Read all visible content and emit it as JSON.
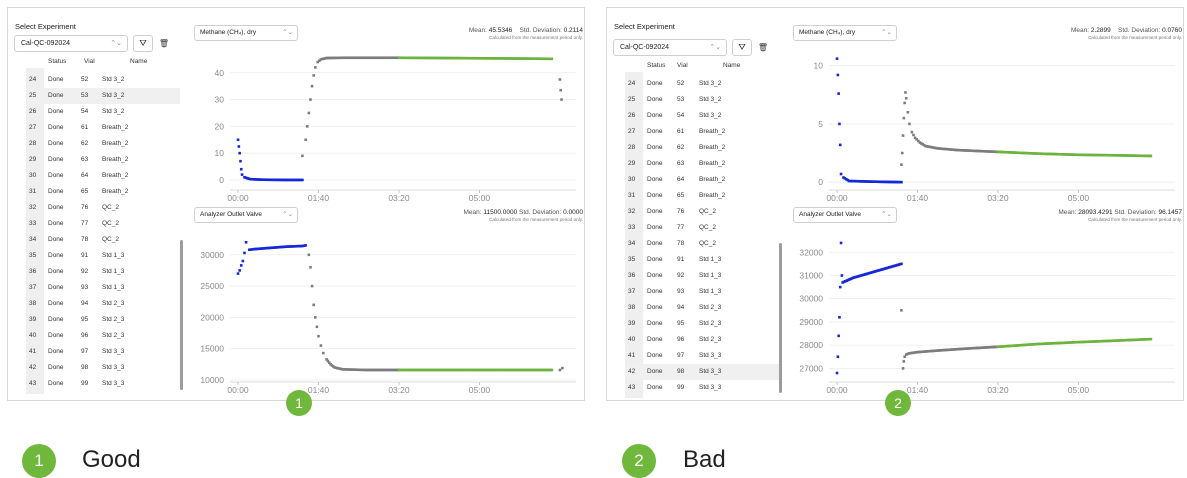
{
  "panels": [
    {
      "select_title": "Select Experiment",
      "experiment": "Cal-QC-092024",
      "columns": [
        "Status",
        "Vial",
        "Name"
      ],
      "rows": [
        {
          "n": "24",
          "status": "Done",
          "vial": "52",
          "name": "Std 3_2"
        },
        {
          "n": "25",
          "status": "Done",
          "vial": "53",
          "name": "Std 3_2"
        },
        {
          "n": "26",
          "status": "Done",
          "vial": "54",
          "name": "Std 3_2"
        },
        {
          "n": "27",
          "status": "Done",
          "vial": "61",
          "name": "Breath_2"
        },
        {
          "n": "28",
          "status": "Done",
          "vial": "62",
          "name": "Breath_2"
        },
        {
          "n": "29",
          "status": "Done",
          "vial": "63",
          "name": "Breath_2"
        },
        {
          "n": "30",
          "status": "Done",
          "vial": "64",
          "name": "Breath_2"
        },
        {
          "n": "31",
          "status": "Done",
          "vial": "65",
          "name": "Breath_2"
        },
        {
          "n": "32",
          "status": "Done",
          "vial": "76",
          "name": "QC_2"
        },
        {
          "n": "33",
          "status": "Done",
          "vial": "77",
          "name": "QC_2"
        },
        {
          "n": "34",
          "status": "Done",
          "vial": "78",
          "name": "QC_2"
        },
        {
          "n": "35",
          "status": "Done",
          "vial": "91",
          "name": "Std 1_3"
        },
        {
          "n": "36",
          "status": "Done",
          "vial": "92",
          "name": "Std 1_3"
        },
        {
          "n": "37",
          "status": "Done",
          "vial": "93",
          "name": "Std 1_3"
        },
        {
          "n": "38",
          "status": "Done",
          "vial": "94",
          "name": "Std 2_3"
        },
        {
          "n": "39",
          "status": "Done",
          "vial": "95",
          "name": "Std 2_3"
        },
        {
          "n": "40",
          "status": "Done",
          "vial": "96",
          "name": "Std 2_3"
        },
        {
          "n": "41",
          "status": "Done",
          "vial": "97",
          "name": "Std 3_3"
        },
        {
          "n": "42",
          "status": "Done",
          "vial": "98",
          "name": "Std 3_3"
        },
        {
          "n": "43",
          "status": "Done",
          "vial": "99",
          "name": "Std 3_3"
        }
      ],
      "selected_row": "25",
      "chart1": {
        "select": "Methane (CH₄), dry",
        "mean_label": "Mean:",
        "mean": "45.5346",
        "sd_label": "Std. Deviation:",
        "sd": "0.2114",
        "note": "Calculated from the measurement period only."
      },
      "chart2": {
        "select": "Analyzer Outlet Valve",
        "mean_label": "Mean:",
        "mean": "11500.0000",
        "sd_label": "Std. Deviation:",
        "sd": "0.0000",
        "note": "Calculated from the measurement period only."
      },
      "badge": "1",
      "caption": "Good"
    },
    {
      "select_title": "Select Experiment",
      "experiment": "Cal-QC-092024",
      "columns": [
        "Status",
        "Vial",
        "Name"
      ],
      "rows": [
        {
          "n": "24",
          "status": "Done",
          "vial": "52",
          "name": "Std 3_2"
        },
        {
          "n": "25",
          "status": "Done",
          "vial": "53",
          "name": "Std 3_2"
        },
        {
          "n": "26",
          "status": "Done",
          "vial": "54",
          "name": "Std 3_2"
        },
        {
          "n": "27",
          "status": "Done",
          "vial": "61",
          "name": "Breath_2"
        },
        {
          "n": "28",
          "status": "Done",
          "vial": "62",
          "name": "Breath_2"
        },
        {
          "n": "29",
          "status": "Done",
          "vial": "63",
          "name": "Breath_2"
        },
        {
          "n": "30",
          "status": "Done",
          "vial": "64",
          "name": "Breath_2"
        },
        {
          "n": "31",
          "status": "Done",
          "vial": "65",
          "name": "Breath_2"
        },
        {
          "n": "32",
          "status": "Done",
          "vial": "76",
          "name": "QC_2"
        },
        {
          "n": "33",
          "status": "Done",
          "vial": "77",
          "name": "QC_2"
        },
        {
          "n": "34",
          "status": "Done",
          "vial": "78",
          "name": "QC_2"
        },
        {
          "n": "35",
          "status": "Done",
          "vial": "91",
          "name": "Std 1_3"
        },
        {
          "n": "36",
          "status": "Done",
          "vial": "92",
          "name": "Std 1_3"
        },
        {
          "n": "37",
          "status": "Done",
          "vial": "93",
          "name": "Std 1_3"
        },
        {
          "n": "38",
          "status": "Done",
          "vial": "94",
          "name": "Std 2_3"
        },
        {
          "n": "39",
          "status": "Done",
          "vial": "95",
          "name": "Std 2_3"
        },
        {
          "n": "40",
          "status": "Done",
          "vial": "96",
          "name": "Std 2_3"
        },
        {
          "n": "41",
          "status": "Done",
          "vial": "97",
          "name": "Std 3_3"
        },
        {
          "n": "42",
          "status": "Done",
          "vial": "98",
          "name": "Std 3_3"
        },
        {
          "n": "43",
          "status": "Done",
          "vial": "99",
          "name": "Std 3_3"
        }
      ],
      "selected_row": "42",
      "chart1": {
        "select": "Methane (CH₄), dry",
        "mean_label": "Mean:",
        "mean": "2.2899",
        "sd_label": "Std. Deviation:",
        "sd": "0.0760",
        "note": "Calculated from the measurement period only."
      },
      "chart2": {
        "select": "Analyzer Outlet Valve",
        "mean_label": "Mean:",
        "mean": "28093.4291",
        "sd_label": "Std. Deviation:",
        "sd": "96.1457",
        "note": "Calculated from the measurement period only."
      },
      "badge": "2",
      "caption": "Bad"
    }
  ],
  "colors": {
    "blue": "#1428d8",
    "grey": "#7d7d7d",
    "green": "#6cb33f",
    "badge": "#70b83c"
  },
  "icons": {
    "filter": "filter-icon",
    "trash": "trash-icon",
    "chevron": "chevron-updown-icon"
  },
  "chart_data": [
    {
      "type": "scatter",
      "panel": "1",
      "title": "",
      "xlabel": "",
      "ylabel": "",
      "xticks": [
        "00:00",
        "01:40",
        "03:20",
        "05:00"
      ],
      "xlim": [
        -10,
        420
      ],
      "ylim": [
        -3,
        47
      ],
      "yticks": [
        0,
        10,
        20,
        30,
        40
      ],
      "series": [
        {
          "color": "blue",
          "points": [
            [
              0,
              15
            ],
            [
              1,
              12.5
            ],
            [
              2,
              10
            ],
            [
              3,
              7
            ],
            [
              4,
              4
            ],
            [
              5,
              2
            ],
            [
              8,
              1
            ],
            [
              15,
              0.3
            ],
            [
              30,
              0.1
            ],
            [
              60,
              0
            ],
            [
              80,
              0
            ]
          ]
        },
        {
          "color": "grey",
          "points": [
            [
              80,
              9
            ],
            [
              84,
              15
            ],
            [
              86,
              20
            ],
            [
              88,
              25
            ],
            [
              90,
              30
            ],
            [
              92,
              35
            ],
            [
              94,
              39
            ],
            [
              96,
              42
            ],
            [
              99,
              44
            ],
            [
              103,
              45
            ],
            [
              110,
              45.5
            ],
            [
              130,
              45.6
            ],
            [
              160,
              45.6
            ],
            [
              200,
              45.6
            ]
          ]
        },
        {
          "color": "green",
          "points": [
            [
              200,
              45.6
            ],
            [
              250,
              45.5
            ],
            [
              300,
              45.4
            ],
            [
              350,
              45.3
            ],
            [
              390,
              45.2
            ]
          ]
        },
        {
          "color": "grey",
          "points": [
            [
              400,
              37.5
            ],
            [
              401,
              33.5
            ],
            [
              402,
              30
            ]
          ]
        }
      ]
    },
    {
      "type": "scatter",
      "panel": "1",
      "title": "",
      "xlabel": "",
      "ylabel": "",
      "xticks": [
        "00:00",
        "01:40",
        "03:20",
        "05:00"
      ],
      "xlim": [
        -10,
        420
      ],
      "ylim": [
        10000,
        33000
      ],
      "yticks": [
        10000,
        15000,
        20000,
        25000,
        30000
      ],
      "series": [
        {
          "color": "blue",
          "points": [
            [
              0,
              27000
            ],
            [
              2,
              27500
            ],
            [
              4,
              28300
            ],
            [
              6,
              29000
            ],
            [
              8,
              30300
            ],
            [
              10,
              32000
            ],
            [
              14,
              30800
            ],
            [
              20,
              30900
            ],
            [
              40,
              31100
            ],
            [
              60,
              31300
            ],
            [
              80,
              31400
            ],
            [
              84,
              31500
            ]
          ]
        },
        {
          "color": "grey",
          "points": [
            [
              88,
              30000
            ],
            [
              90,
              28000
            ],
            [
              92,
              25000
            ],
            [
              94,
              22000
            ],
            [
              96,
              20000
            ],
            [
              98,
              18500
            ],
            [
              100,
              17000
            ],
            [
              103,
              15500
            ],
            [
              106,
              14300
            ],
            [
              110,
              13300
            ],
            [
              115,
              12500
            ],
            [
              120,
              12000
            ],
            [
              130,
              11700
            ],
            [
              160,
              11600
            ],
            [
              200,
              11600
            ]
          ]
        },
        {
          "color": "green",
          "points": [
            [
              200,
              11600
            ],
            [
              250,
              11600
            ],
            [
              300,
              11600
            ],
            [
              350,
              11600
            ],
            [
              390,
              11600
            ]
          ]
        },
        {
          "color": "grey",
          "points": [
            [
              400,
              11600
            ],
            [
              403,
              11900
            ]
          ]
        }
      ]
    },
    {
      "type": "scatter",
      "panel": "2",
      "title": "",
      "xlabel": "",
      "ylabel": "",
      "xticks": [
        "00:00",
        "01:40",
        "03:20",
        "05:00"
      ],
      "xlim": [
        -10,
        420
      ],
      "ylim": [
        -0.5,
        11
      ],
      "yticks": [
        0,
        5,
        10
      ],
      "series": [
        {
          "color": "blue",
          "points": [
            [
              0,
              10.6
            ],
            [
              1,
              9.2
            ],
            [
              2,
              7.6
            ],
            [
              3,
              5
            ],
            [
              4,
              3.2
            ],
            [
              5,
              0.7
            ],
            [
              8,
              0.4
            ],
            [
              15,
              0.1
            ],
            [
              40,
              0.05
            ],
            [
              80,
              0
            ]
          ]
        },
        {
          "color": "grey",
          "points": [
            [
              80,
              1.5
            ],
            [
              81,
              2.5
            ],
            [
              82,
              4
            ],
            [
              83,
              5.5
            ],
            [
              84,
              6.8
            ],
            [
              85,
              7.7
            ],
            [
              86,
              7.2
            ],
            [
              88,
              6
            ],
            [
              90,
              5
            ],
            [
              93,
              4.3
            ],
            [
              97,
              3.8
            ],
            [
              103,
              3.4
            ],
            [
              110,
              3.1
            ],
            [
              125,
              2.9
            ],
            [
              150,
              2.75
            ],
            [
              200,
              2.6
            ]
          ]
        },
        {
          "color": "green",
          "points": [
            [
              200,
              2.6
            ],
            [
              250,
              2.45
            ],
            [
              300,
              2.35
            ],
            [
              350,
              2.3
            ],
            [
              390,
              2.25
            ]
          ]
        }
      ]
    },
    {
      "type": "scatter",
      "panel": "2",
      "title": "",
      "xlabel": "",
      "ylabel": "",
      "xticks": [
        "00:00",
        "01:40",
        "03:20",
        "05:00"
      ],
      "xlim": [
        -10,
        420
      ],
      "ylim": [
        26500,
        32700
      ],
      "yticks": [
        27000,
        28000,
        29000,
        30000,
        31000,
        32000
      ],
      "series": [
        {
          "color": "blue",
          "points": [
            [
              0,
              26800
            ],
            [
              1,
              27500
            ],
            [
              2,
              28400
            ],
            [
              3,
              29200
            ],
            [
              4,
              30500
            ],
            [
              5,
              32400
            ],
            [
              6,
              31000
            ],
            [
              7,
              30700
            ],
            [
              20,
              30900
            ],
            [
              40,
              31100
            ],
            [
              60,
              31300
            ],
            [
              80,
              31500
            ]
          ]
        },
        {
          "color": "grey",
          "points": [
            [
              80,
              29500
            ],
            [
              82,
              27000
            ],
            [
              83,
              27300
            ],
            [
              84,
              27500
            ],
            [
              86,
              27600
            ],
            [
              90,
              27650
            ],
            [
              100,
              27700
            ],
            [
              130,
              27780
            ],
            [
              160,
              27850
            ],
            [
              200,
              27930
            ]
          ]
        },
        {
          "color": "green",
          "points": [
            [
              200,
              27930
            ],
            [
              250,
              28050
            ],
            [
              300,
              28130
            ],
            [
              350,
              28200
            ],
            [
              390,
              28260
            ]
          ]
        }
      ]
    }
  ]
}
